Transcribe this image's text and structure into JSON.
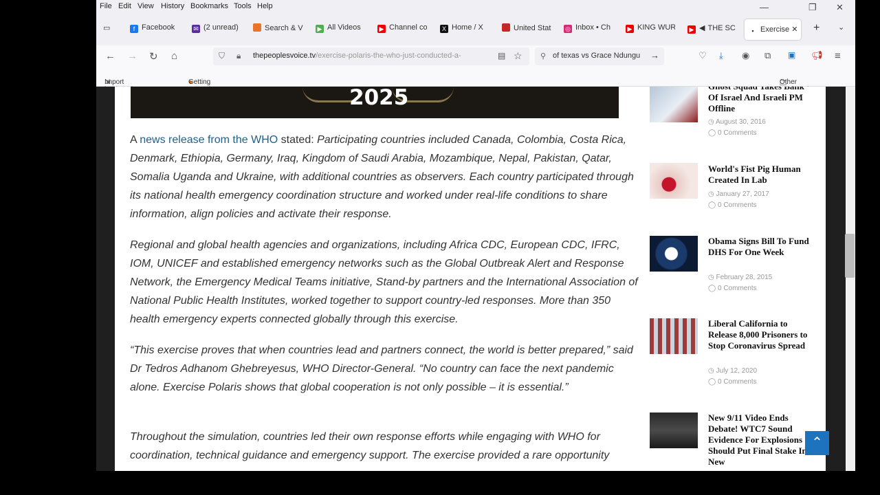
{
  "menu": [
    "File",
    "Edit",
    "View",
    "History",
    "Bookmarks",
    "Tools",
    "Help"
  ],
  "tabs": [
    {
      "label": "Facebook",
      "icon": "facebook-icon",
      "color": "#1877f2"
    },
    {
      "label": "(2 unread)",
      "icon": "mail-icon",
      "color": "#5a2ca0"
    },
    {
      "label": "Search & V",
      "icon": "search-engine-icon",
      "color": "#e8752b"
    },
    {
      "label": "All Videos",
      "icon": "video-play-icon",
      "color": "#4caf50"
    },
    {
      "label": "Channel co",
      "icon": "youtube-icon",
      "color": "#e00"
    },
    {
      "label": "Home / X",
      "icon": "x-icon",
      "color": "#111"
    },
    {
      "label": "United Stat",
      "icon": "tab-icon",
      "color": "#c62828"
    },
    {
      "label": "Inbox • Ch",
      "icon": "instagram-icon",
      "color": "#d62976"
    },
    {
      "label": "KING WUR",
      "icon": "youtube-icon",
      "color": "#e00"
    },
    {
      "label": "THE SC",
      "icon": "youtube-icon",
      "color": "#e00"
    },
    {
      "label": "Exercise",
      "icon": "site-icon",
      "color": "#333",
      "active": true
    }
  ],
  "url": {
    "domain": "thepeoplesvoice.tv",
    "path": "/exercise-polaris-the-who-just-conducted-a-"
  },
  "search_text": "of texas vs Grace Ndungu",
  "bookmarks": {
    "import": "Import bookmarks...",
    "getting_started": "Getting Started",
    "other": "Other Bookmarks"
  },
  "banner_year": "2025",
  "article": {
    "p1_prefix": "A ",
    "p1_link": "news release from the WHO",
    "p1_stated": " stated: ",
    "p1_body": "Participating countries included Canada, Colombia, Costa Rica, Denmark, Ethiopia, Germany, Iraq, Kingdom of Saudi Arabia, Mozambique, Nepal, Pakistan, Qatar, Somalia Uganda and Ukraine, with additional countries as observers. Each country participated through its national health emergency coordination structure and worked under real-life conditions to share information, align policies and activate their response.",
    "p2": "Regional and global health agencies and organizations, including Africa CDC, European CDC, IFRC, IOM, UNICEF and established emergency networks such as the Global Outbreak Alert and Response Network, the Emergency Medical Teams initiative, Stand-by partners and the International Association of National Public Health Institutes, worked together to support country-led responses. More than 350 health emergency experts connected globally through this exercise.",
    "p3": "“This exercise proves that when countries lead and partners connect, the world is better prepared,” said Dr Tedros Adhanom Ghebreyesus, WHO Director-General. “No country can face the next pandemic alone. Exercise Polaris shows that global cooperation is not only possible – it is essential.”",
    "p4": "Throughout the simulation, countries led their own response efforts while engaging with WHO for coordination, technical guidance and emergency support. The exercise provided a rare opportunity"
  },
  "sidebar": [
    {
      "title": "Ghost Squad Takes Bank Of Israel And Israeli PM Offline",
      "date": "August 30, 2016",
      "comments": "0 Comments"
    },
    {
      "title": "World's Fist Pig Human Created In Lab",
      "date": "January 27, 2017",
      "comments": "0 Comments"
    },
    {
      "title": "Obama Signs Bill To Fund DHS For One Week",
      "date": "February 28, 2015",
      "comments": "0 Comments"
    },
    {
      "title": "Liberal California to Release 8,000 Prisoners to Stop Coronavirus Spread",
      "date": "July 12, 2020",
      "comments": "0 Comments"
    },
    {
      "title": "New 9/11 Video Ends Debate! WTC7 Sound Evidence For Explosions Should Put Final Stake In New",
      "date": "",
      "comments": ""
    }
  ]
}
